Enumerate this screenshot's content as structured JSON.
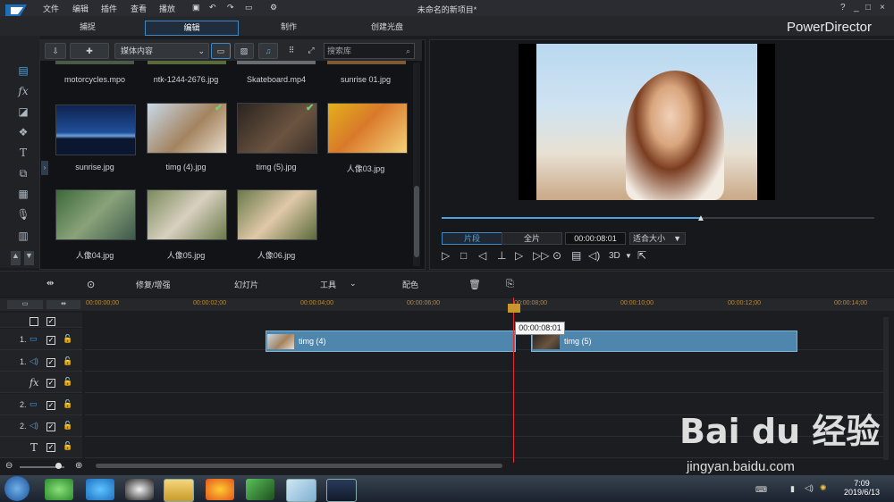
{
  "app": {
    "menus": [
      "文件",
      "编辑",
      "插件",
      "查看",
      "播放"
    ],
    "title": "未命名的新项目*",
    "brand": "PowerDirector",
    "window_controls": [
      "?",
      "_",
      "□",
      "×"
    ]
  },
  "modes": {
    "capture": "捕捉",
    "edit": "编辑",
    "produce": "制作",
    "disc": "创建光盘"
  },
  "library": {
    "media_select": "媒体内容",
    "search_placeholder": "搜索库",
    "row1_labels": [
      "motorcycles.mpo",
      "ntk-1244-2676.jpg",
      "Skateboard.mp4",
      "sunrise 01.jpg"
    ],
    "items": [
      {
        "label": "sunrise.jpg",
        "checked": false
      },
      {
        "label": "timg (4).jpg",
        "checked": true
      },
      {
        "label": "timg (5).jpg",
        "checked": true
      },
      {
        "label": "人像03.jpg",
        "checked": false
      },
      {
        "label": "人像04.jpg",
        "checked": false
      },
      {
        "label": "人像05.jpg",
        "checked": false
      },
      {
        "label": "人像06.jpg",
        "checked": false
      }
    ]
  },
  "preview": {
    "tab_clip": "片段",
    "tab_full": "全片",
    "timecode": "00:00:08:01",
    "fit": "适合大小",
    "three_d": "3D",
    "progress": 0.6
  },
  "toolbar": {
    "fix": "修复/增强",
    "slideshow": "幻灯片",
    "tools": "工具",
    "dub": "配色"
  },
  "timeline": {
    "ruler": [
      "00:00:00;00",
      "00:00:02;00",
      "00:00:04;00",
      "00:00:06;00",
      "00:00:08;00",
      "00:00:10;00",
      "00:00:12;00",
      "00:00:14;00"
    ],
    "tooltip": "00:00:08:01",
    "track_labels": [
      "1.",
      "1.",
      "",
      "2.",
      "2.",
      ""
    ],
    "clip1": "timg (4)",
    "clip2": "timg (5)"
  },
  "taskbar": {
    "time": "7:09",
    "date": "2019/6/13"
  },
  "watermark": {
    "main": "Bai du 经验",
    "sub": "jingyan.baidu.com"
  }
}
